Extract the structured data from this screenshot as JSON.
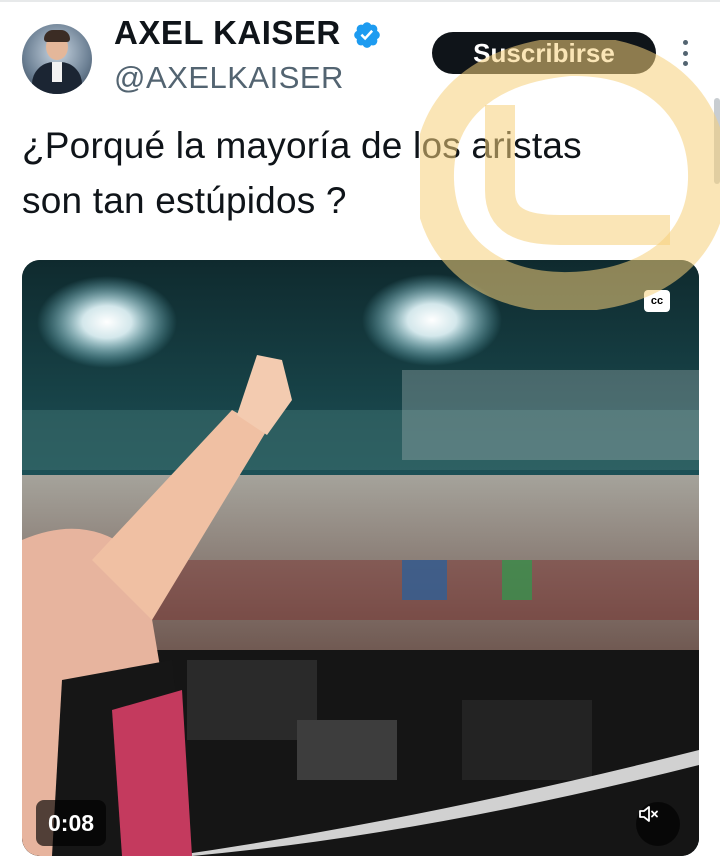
{
  "author": {
    "name": "AXEL KAISER",
    "handle": "@AXELKAISER",
    "verified": true,
    "verified_color": "#1d9bf0"
  },
  "actions": {
    "subscribe_label": "Suscribirse",
    "more_icon": "more-vertical-icon"
  },
  "tweet": {
    "text": "¿Porqué la mayoría de los aristas\nson tan estúpidos ?"
  },
  "video": {
    "elapsed": "0:08",
    "captions_label": "cc",
    "mute_icon": "speaker-muted-icon"
  },
  "colors": {
    "text": "#0f1419",
    "secondary": "#536471",
    "button_bg": "#0f1419",
    "watermark": "#f5cf7a"
  }
}
